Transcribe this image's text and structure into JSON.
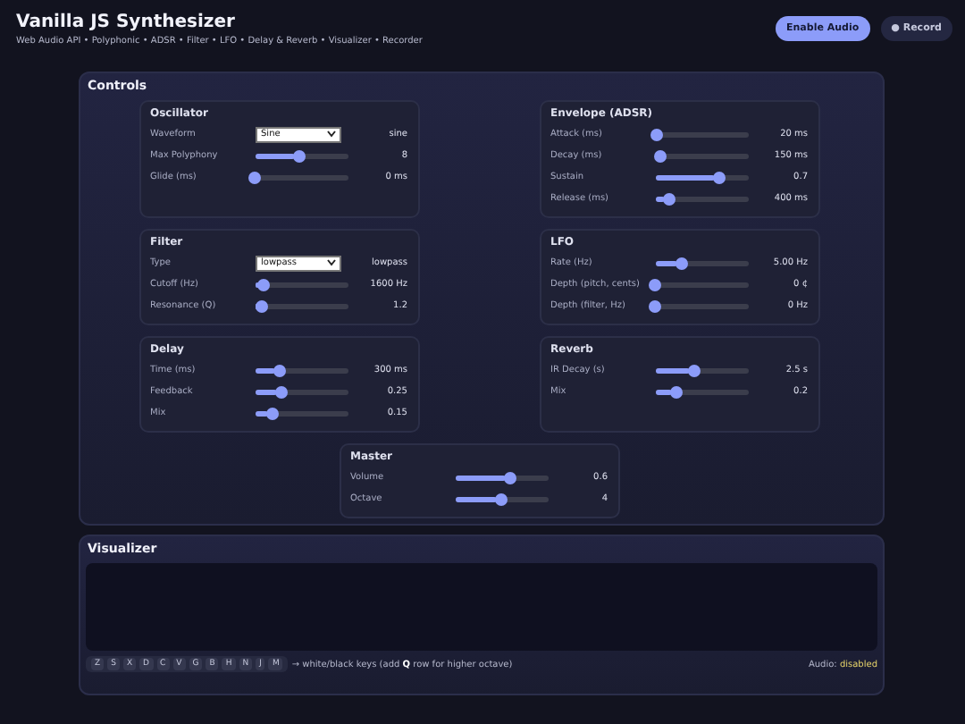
{
  "header": {
    "title": "Vanilla JS Synthesizer",
    "subtitle": "Web Audio API • Polyphonic • ADSR • Filter • LFO • Delay & Reverb • Visualizer • Recorder",
    "buttons": [
      {
        "label": "Enable Audio",
        "kind": "primary"
      },
      {
        "label": "● Record",
        "kind": "secondary"
      }
    ]
  },
  "controls": {
    "title": "Controls",
    "cards": [
      {
        "title": "Oscillator",
        "rows": [
          {
            "kind": "select",
            "label": "Waveform",
            "value": "Sine",
            "reading": "sine"
          },
          {
            "kind": "slider",
            "label": "Max Polyphony",
            "level": 0.48,
            "reading": "8"
          },
          {
            "kind": "slider",
            "label": "Glide (ms)",
            "level": 0,
            "reading": "0 ms"
          }
        ]
      },
      {
        "title": "Envelope (ADSR)",
        "rows": [
          {
            "kind": "slider",
            "label": "Attack (ms)",
            "level": 0.02,
            "reading": "20 ms"
          },
          {
            "kind": "slider",
            "label": "Decay (ms)",
            "level": 0.06,
            "reading": "150 ms"
          },
          {
            "kind": "slider",
            "label": "Sustain",
            "level": 0.7,
            "reading": "0.7"
          },
          {
            "kind": "slider",
            "label": "Release (ms)",
            "level": 0.15,
            "reading": "400 ms"
          }
        ]
      },
      {
        "title": "Filter",
        "rows": [
          {
            "kind": "select",
            "label": "Type",
            "value": "lowpass",
            "reading": "lowpass"
          },
          {
            "kind": "slider",
            "label": "Cutoff (Hz)",
            "level": 0.1,
            "reading": "1600 Hz"
          },
          {
            "kind": "slider",
            "label": "Resonance (Q)",
            "level": 0.08,
            "reading": "1.2"
          }
        ]
      },
      {
        "title": "LFO",
        "rows": [
          {
            "kind": "slider",
            "label": "Rate (Hz)",
            "level": 0.28,
            "reading": "5.00 Hz"
          },
          {
            "kind": "slider",
            "label": "Depth (pitch, cents)",
            "level": 0,
            "reading": "0 ¢"
          },
          {
            "kind": "slider",
            "label": "Depth (filter, Hz)",
            "level": 0,
            "reading": "0 Hz"
          }
        ]
      },
      {
        "title": "Delay",
        "rows": [
          {
            "kind": "slider",
            "label": "Time (ms)",
            "level": 0.26,
            "reading": "300 ms"
          },
          {
            "kind": "slider",
            "label": "Feedback",
            "level": 0.29,
            "reading": "0.25"
          },
          {
            "kind": "slider",
            "label": "Mix",
            "level": 0.19,
            "reading": "0.15"
          }
        ]
      },
      {
        "title": "Reverb",
        "rows": [
          {
            "kind": "slider",
            "label": "IR Decay (s)",
            "level": 0.42,
            "reading": "2.5 s"
          },
          {
            "kind": "slider",
            "label": "Mix",
            "level": 0.23,
            "reading": "0.2"
          }
        ]
      },
      {
        "title": "Master",
        "rows": [
          {
            "kind": "slider",
            "label": "Volume",
            "level": 0.6,
            "reading": "0.6"
          },
          {
            "kind": "slider",
            "label": "Octave",
            "level": 0.5,
            "reading": "4"
          }
        ]
      }
    ]
  },
  "visualizer": {
    "title": "Visualizer",
    "keys": [
      "Z",
      "S",
      "X",
      "D",
      "C",
      "V",
      "G",
      "B",
      "H",
      "N",
      "J",
      "M"
    ],
    "hint": "→ white/black keys (add **Q** row for higher octave)",
    "audio_label": "Audio:",
    "audio_state": "disabled"
  }
}
